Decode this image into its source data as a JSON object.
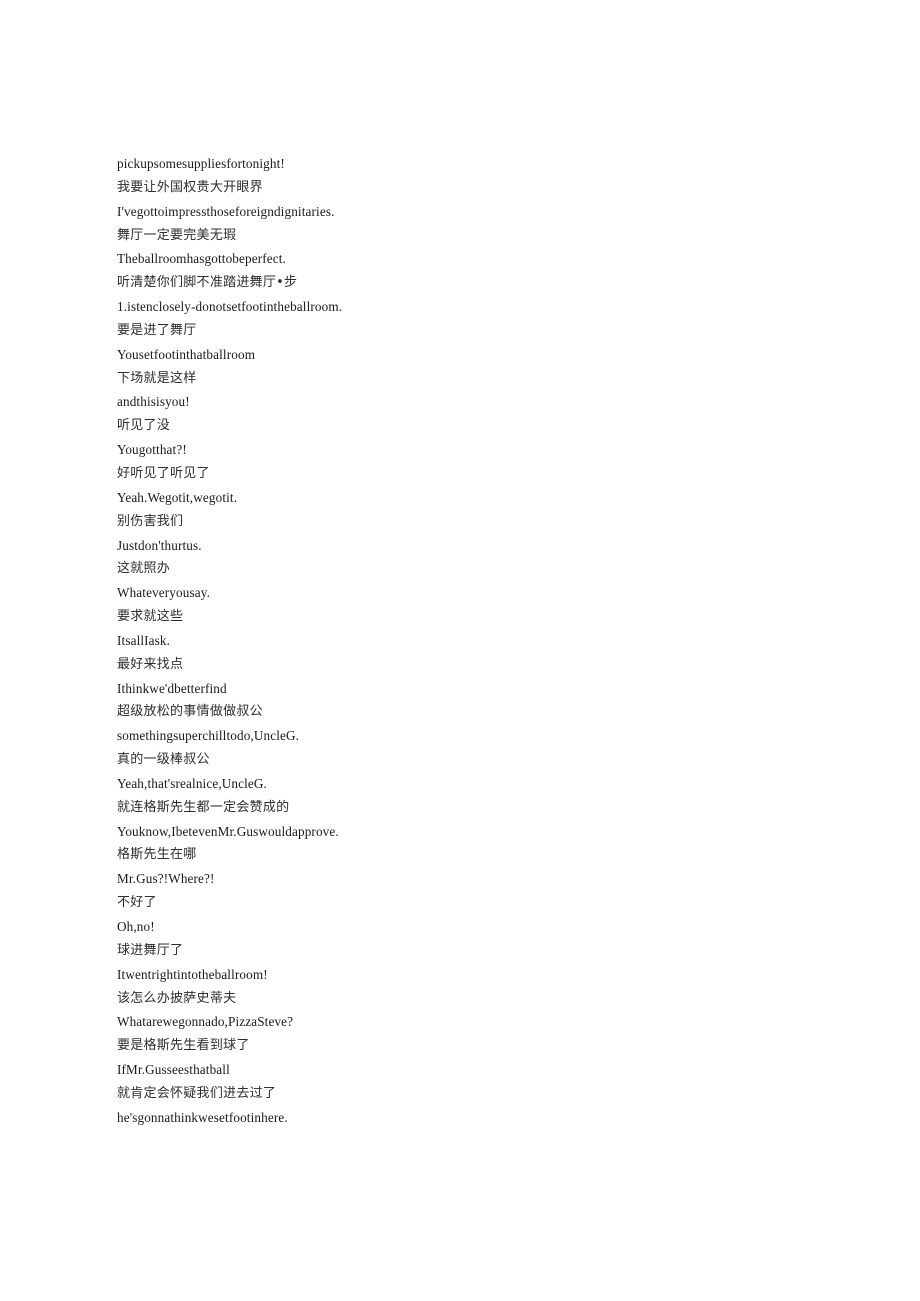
{
  "document": {
    "type": "bilingual-subtitle-transcript",
    "background_color": "#ffffff",
    "text_color_en": "#1a1a1a",
    "text_color_zh": "#2e2e2e",
    "lines": [
      {
        "lang": "en",
        "text": "pickupsomesuppliesfortonight!"
      },
      {
        "lang": "zh",
        "text": "我要让外国权贵大开眼界"
      },
      {
        "lang": "en",
        "text": "I'vegottoimpressthoseforeigndignitaries."
      },
      {
        "lang": "zh",
        "text": "舞厅一定要完美无瑕"
      },
      {
        "lang": "en",
        "text": "Theballroomhasgottobeperfect."
      },
      {
        "lang": "zh",
        "text": "听清楚你们脚不准踏进舞厅•步"
      },
      {
        "lang": "en",
        "text": "1.istenclosely-donotsetfootintheballroom."
      },
      {
        "lang": "zh",
        "text": "要是进了舞厅"
      },
      {
        "lang": "en",
        "text": "Yousetfootinthatballroom"
      },
      {
        "lang": "zh",
        "text": "下场就是这样"
      },
      {
        "lang": "en",
        "text": "andthisisyou!"
      },
      {
        "lang": "zh",
        "text": "听见了没"
      },
      {
        "lang": "en",
        "text": "Yougotthat?!"
      },
      {
        "lang": "zh",
        "text": "好听见了听见了"
      },
      {
        "lang": "en",
        "text": "Yeah.Wegotit,wegotit."
      },
      {
        "lang": "zh",
        "text": "别伤害我们"
      },
      {
        "lang": "en",
        "text": "Justdon'thurtus."
      },
      {
        "lang": "zh",
        "text": "这就照办"
      },
      {
        "lang": "en",
        "text": "Whateveryousay."
      },
      {
        "lang": "zh",
        "text": "要求就这些"
      },
      {
        "lang": "en",
        "text": "ItsallIask."
      },
      {
        "lang": "zh",
        "text": "最好来找点"
      },
      {
        "lang": "en",
        "text": "Ithinkwe'dbetterfind"
      },
      {
        "lang": "zh",
        "text": "超级放松的事情做做叔公"
      },
      {
        "lang": "en",
        "text": "somethingsuperchilltodo,UncleG."
      },
      {
        "lang": "zh",
        "text": "真的一级棒叔公"
      },
      {
        "lang": "en",
        "text": "Yeah,that'srealnice,UncleG."
      },
      {
        "lang": "zh",
        "text": "就连格斯先生都一定会赞成的"
      },
      {
        "lang": "en",
        "text": "Youknow,IbetevenMr.Guswouldapprove."
      },
      {
        "lang": "zh",
        "text": "格斯先生在哪"
      },
      {
        "lang": "en",
        "text": "Mr.Gus?!Where?!"
      },
      {
        "lang": "zh",
        "text": "不好了"
      },
      {
        "lang": "en",
        "text": "Oh,no!"
      },
      {
        "lang": "zh",
        "text": "球进舞厅了"
      },
      {
        "lang": "en",
        "text": "Itwentrightintotheballroom!"
      },
      {
        "lang": "zh",
        "text": "该怎么办披萨史蒂夫"
      },
      {
        "lang": "en",
        "text": "Whatarewegonnado,PizzaSteve?"
      },
      {
        "lang": "zh",
        "text": "要是格斯先生看到球了"
      },
      {
        "lang": "en",
        "text": "IfMr.Gusseesthatball"
      },
      {
        "lang": "zh",
        "text": "就肯定会怀疑我们进去过了"
      },
      {
        "lang": "en",
        "text": "he'sgonnathinkwesetfootinhere."
      }
    ]
  }
}
